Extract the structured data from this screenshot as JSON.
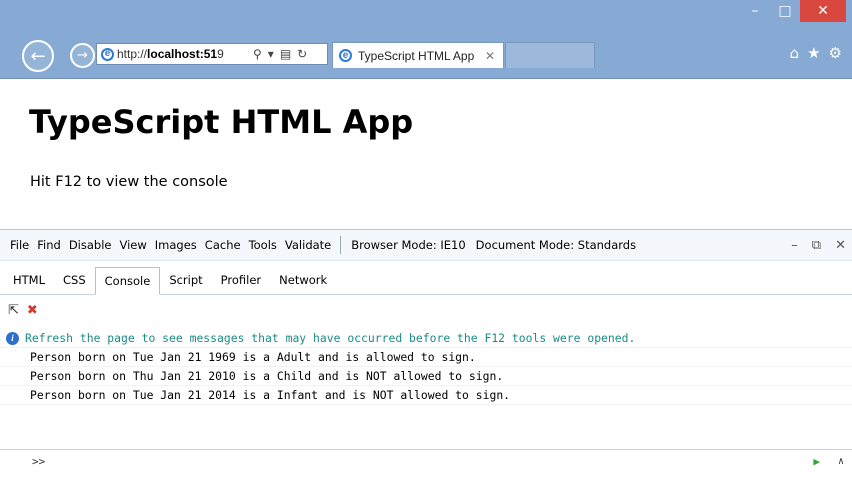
{
  "browser": {
    "url_prefix": "http://",
    "url_host": "localhost:51",
    "url_suffix": "9",
    "tab_title": "TypeScript HTML App"
  },
  "page": {
    "heading": "TypeScript HTML App",
    "subtext": "Hit F12 to view the console"
  },
  "devtools": {
    "menu": [
      "File",
      "Find",
      "Disable",
      "View",
      "Images",
      "Cache",
      "Tools",
      "Validate"
    ],
    "browser_mode": "Browser Mode: IE10",
    "document_mode": "Document Mode: Standards",
    "tabs": [
      "HTML",
      "CSS",
      "Console",
      "Script",
      "Profiler",
      "Network"
    ],
    "active_tab": "Console",
    "console": {
      "info": "Refresh the page to see messages that may have occurred before the F12 tools were opened.",
      "lines": [
        "Person born on Tue Jan 21 1969 is a Adult and is allowed to sign.",
        "Person born on Thu Jan 21 2010 is a Child and is NOT allowed to sign.",
        "Person born on Tue Jan 21 2014 is a Infant and is NOT allowed to sign."
      ],
      "prompt": ">>"
    }
  }
}
